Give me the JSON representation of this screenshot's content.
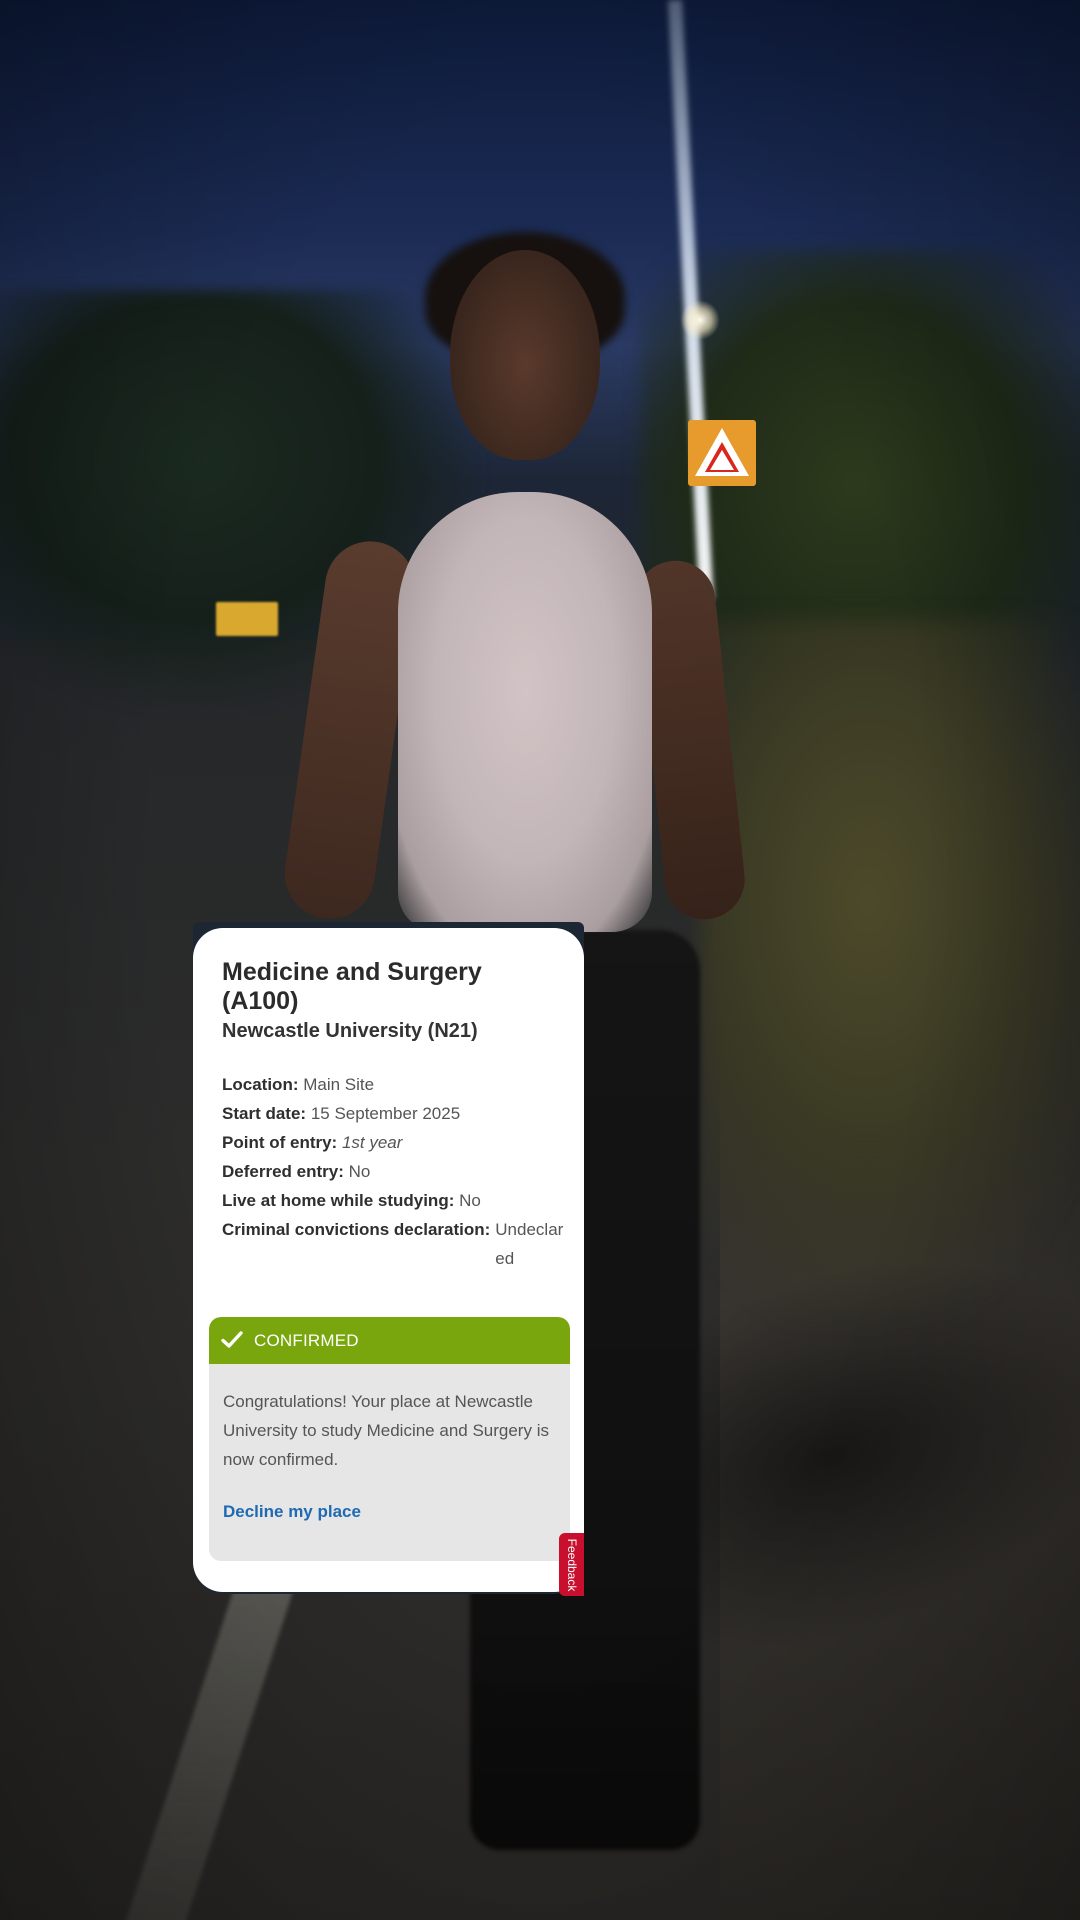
{
  "course": {
    "title": "Medicine and Surgery (A100)",
    "university": "Newcastle University (N21)"
  },
  "details": [
    {
      "label": "Location:",
      "value": "Main Site"
    },
    {
      "label": "Start date:",
      "value": "15 September 2025"
    },
    {
      "label": "Point of entry:",
      "value": "1st year"
    },
    {
      "label": "Deferred entry:",
      "value": "No"
    },
    {
      "label": "Live at home while studying:",
      "value": "No"
    },
    {
      "label": "Criminal convictions declaration:",
      "value": "Undeclared"
    }
  ],
  "status": {
    "label": "CONFIRMED",
    "color": "#79a60d",
    "icon": "checkmark-icon",
    "message": "Congratulations! Your place at Newcastle University to study Medicine and Surgery is now confirmed.",
    "decline_link": "Decline my place",
    "link_color": "#1f6ab3"
  },
  "feedback": {
    "label": "Feedback",
    "color": "#c8102e"
  }
}
